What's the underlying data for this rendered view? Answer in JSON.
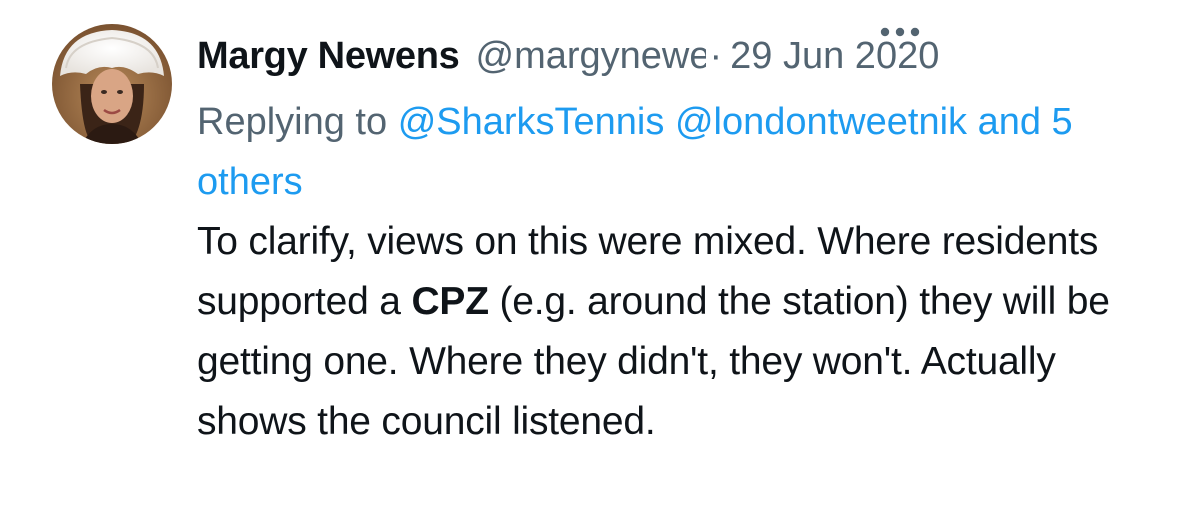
{
  "tweet": {
    "author": {
      "display_name": "Margy Newens",
      "handle": "@margynewens",
      "avatar_alt": "profile photo"
    },
    "date_separator": "·",
    "date": "29 Jun 2020",
    "more_icon": "more-horizontal-icon",
    "reply": {
      "prefix": "Replying to",
      "mention_1": "@SharksTennis",
      "mention_2": "@londontweetnik",
      "others": "and 5 others"
    },
    "text": {
      "part_1": "To clarify, views on this were mixed. Where residents supported a ",
      "bold": "CPZ",
      "part_2": " (e.g. around the station) they will be getting one. Where they didn't, they won't. Actually shows the council listened."
    },
    "colors": {
      "link": "#1d9bf0",
      "secondary": "#536471",
      "primary": "#0f1419"
    }
  }
}
